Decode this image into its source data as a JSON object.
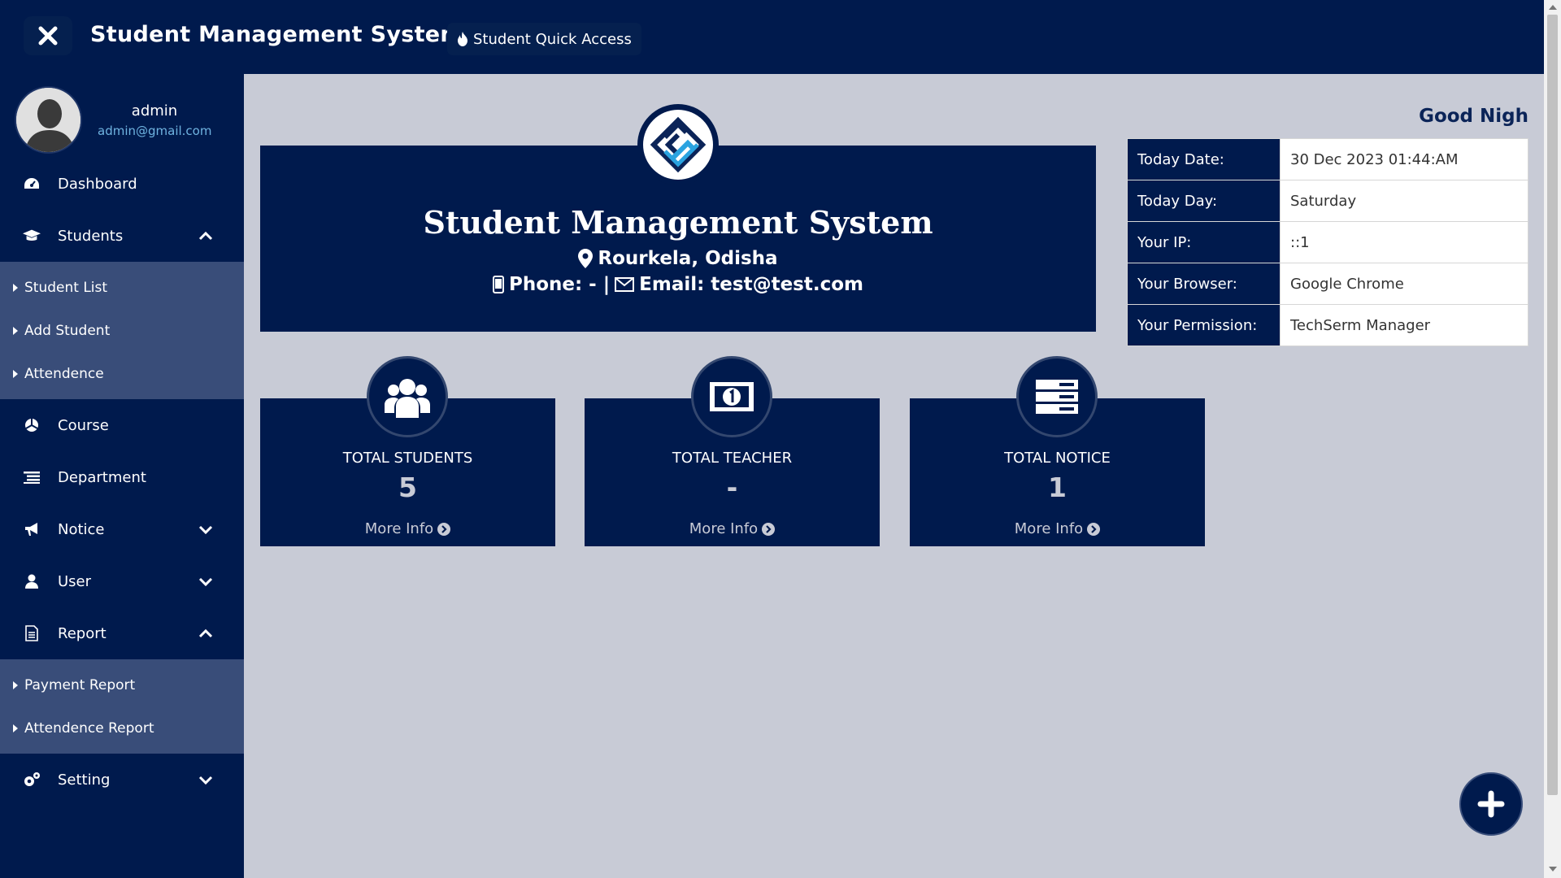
{
  "header": {
    "title": "Student Management System",
    "quick_access": "Student Quick Access"
  },
  "profile": {
    "name": "admin",
    "email": "admin@gmail.com"
  },
  "sidebar": {
    "items": [
      {
        "label": "Dashboard",
        "icon": "dashboard-icon"
      },
      {
        "label": "Students",
        "icon": "graduation-cap-icon",
        "expanded": true,
        "children": [
          "Student List",
          "Add Student",
          "Attendence"
        ]
      },
      {
        "label": "Course",
        "icon": "course-icon"
      },
      {
        "label": "Department",
        "icon": "list-icon"
      },
      {
        "label": "Notice",
        "icon": "megaphone-icon",
        "expanded": false
      },
      {
        "label": "User",
        "icon": "user-icon",
        "expanded": false
      },
      {
        "label": "Report",
        "icon": "report-icon",
        "expanded": true,
        "children": [
          "Payment Report",
          "Attendence Report"
        ]
      },
      {
        "label": "Setting",
        "icon": "gears-icon",
        "expanded": false
      }
    ]
  },
  "banner": {
    "title": "Student Management System",
    "location": "Rourkela, Odisha",
    "phone": "Phone: - |",
    "email": "Email: test@test.com"
  },
  "greeting": "Good Nigh",
  "info": [
    {
      "label": "Today Date:",
      "value": "30 Dec 2023 01:44:AM"
    },
    {
      "label": "Today Day:",
      "value": "Saturday"
    },
    {
      "label": "Your IP:",
      "value": "::1"
    },
    {
      "label": "Your Browser:",
      "value": "Google Chrome"
    },
    {
      "label": "Your Permission:",
      "value": "TechSerm Manager"
    }
  ],
  "stats": [
    {
      "label": "TOTAL STUDENTS",
      "value": "5",
      "more": "More Info",
      "icon": "users-icon"
    },
    {
      "label": "TOTAL TEACHER",
      "value": "-",
      "more": "More Info",
      "icon": "money-icon"
    },
    {
      "label": "TOTAL NOTICE",
      "value": "1",
      "more": "More Info",
      "icon": "server-icon"
    }
  ],
  "colors": {
    "navy": "#001a4d",
    "submenu": "#394d79",
    "content_bg": "#c8cbd6",
    "email_link": "#6fb3e0"
  }
}
